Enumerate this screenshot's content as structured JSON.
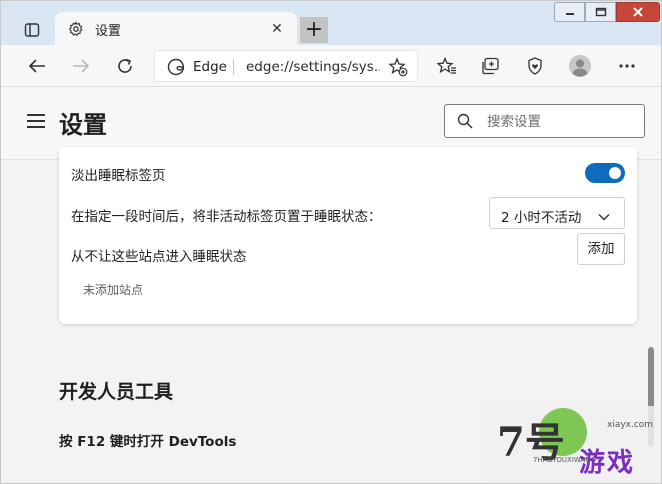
{
  "browser": {
    "tab": {
      "title": "设置",
      "close_glyph": "✕"
    },
    "new_tab_glyph": "+",
    "address": {
      "site_label": "Edge",
      "url": "edge://settings/sys..."
    }
  },
  "settings": {
    "title": "设置",
    "search": {
      "placeholder": "搜索设置"
    },
    "sleeping_tabs": {
      "fade_label": "淡出睡眠标签页",
      "fade_enabled": true,
      "timeout_label": "在指定一段时间后，将非活动标签页置于睡眠状态：",
      "timeout_value": "2 小时不活动",
      "never_sleep_label": "从不让这些站点进入睡眠状态",
      "add_button": "添加",
      "empty_text": "未添加站点"
    },
    "developer_tools": {
      "heading": "开发人员工具",
      "f12_label": "按 F12 键时打开 DevTools"
    }
  },
  "watermark": {
    "logo": "7号",
    "text": "游戏",
    "url": "xiayx.com",
    "pinyin": "7HAOYOUXIWANG"
  },
  "colors": {
    "tabstrip_bg": "#d9e7f5",
    "accent": "#0f6cbd",
    "close_button": "#c7463a"
  },
  "icons": {
    "tab_actions": "tab-actions-icon",
    "tab_favicon": "gear-icon",
    "back": "back-arrow-icon",
    "forward": "forward-arrow-icon",
    "refresh": "refresh-icon",
    "edge": "edge-logo-icon",
    "favorite_add": "star-plus-icon",
    "favorites": "favorites-icon",
    "collections": "collections-icon",
    "browser_essentials": "heart-shield-icon",
    "profile": "profile-avatar-icon",
    "more": "more-icon",
    "menu": "hamburger-icon",
    "search": "search-icon",
    "chevron": "chevron-down-icon"
  }
}
